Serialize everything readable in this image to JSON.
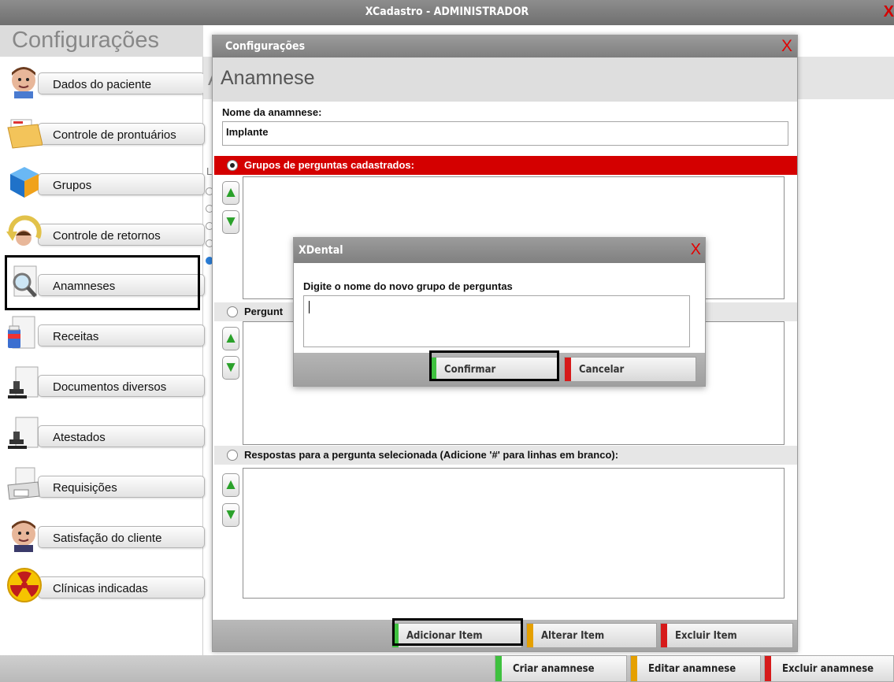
{
  "window": {
    "title": "XCadastro - ADMINISTRADOR",
    "close_glyph": "X"
  },
  "section": {
    "title": "Configurações"
  },
  "sidebar": {
    "items": [
      {
        "label": "Dados do paciente",
        "icon": "patient-face-icon"
      },
      {
        "label": "Controle de prontuários",
        "icon": "folder-records-icon"
      },
      {
        "label": "Grupos",
        "icon": "cube-icon"
      },
      {
        "label": "Controle de retornos",
        "icon": "return-arrow-icon"
      },
      {
        "label": "Anamneses",
        "icon": "magnifier-document-icon"
      },
      {
        "label": "Receitas",
        "icon": "prescription-icon"
      },
      {
        "label": "Documentos diversos",
        "icon": "stamp-document-icon"
      },
      {
        "label": "Atestados",
        "icon": "stamp-document-icon"
      },
      {
        "label": "Requisições",
        "icon": "printer-icon"
      },
      {
        "label": "Satisfação do cliente",
        "icon": "client-face-icon"
      },
      {
        "label": "Clínicas indicadas",
        "icon": "radiation-icon"
      }
    ]
  },
  "background": {
    "head_fragment": "A",
    "ghost_letter": "L"
  },
  "bottombar": {
    "create_label": "Criar anamnese",
    "edit_label": "Editar anamnese",
    "delete_label": "Excluir anamnese"
  },
  "config_dialog": {
    "title": "Configurações",
    "close_glyph": "X",
    "heading": "Anamnese",
    "name_label": "Nome da anamnese:",
    "name_value": "Implante",
    "groups_label": "Grupos de perguntas cadastrados:",
    "questions_label": "Pergunt",
    "answers_label": "Respostas para a pergunta selecionada (Adicione '#' para linhas em branco):",
    "add_item_label": "Adicionar Item",
    "edit_item_label": "Alterar Item",
    "delete_item_label": "Excluir Item"
  },
  "modal": {
    "title": "XDental",
    "close_glyph": "X",
    "prompt": "Digite o nome do novo grupo de perguntas",
    "input_value": "",
    "confirm_label": "Confirmar",
    "cancel_label": "Cancelar"
  },
  "colors": {
    "accent_red": "#d40000",
    "green": "#3fc13f",
    "orange": "#e5a000",
    "red_bar": "#d61a1a"
  }
}
